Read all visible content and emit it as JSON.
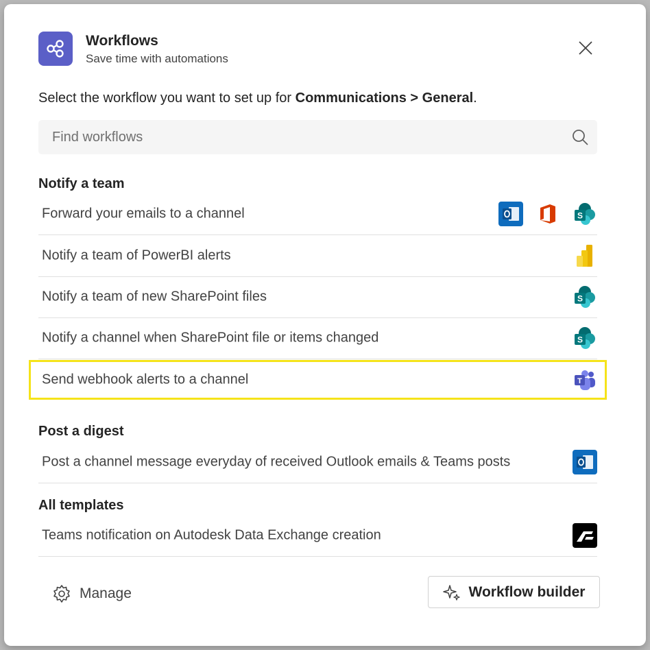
{
  "header": {
    "title": "Workflows",
    "subtitle": "Save time with automations",
    "app_icon": "workflows-icon",
    "close_icon": "close-icon"
  },
  "instruction": {
    "prefix": "Select the workflow you want to set up for ",
    "location": "Communications > General",
    "suffix": "."
  },
  "search": {
    "placeholder": "Find workflows",
    "icon": "search-icon"
  },
  "sections": {
    "notify": {
      "title": "Notify a team",
      "items": [
        {
          "label": "Forward your emails to a channel",
          "icons": [
            "outlook-icon",
            "office-icon",
            "sharepoint-icon"
          ]
        },
        {
          "label": "Notify a team of PowerBI alerts",
          "icons": [
            "powerbi-icon"
          ]
        },
        {
          "label": "Notify a team of new SharePoint files",
          "icons": [
            "sharepoint-icon"
          ]
        },
        {
          "label": "Notify a channel when SharePoint file or items changed",
          "icons": [
            "sharepoint-icon"
          ]
        },
        {
          "label": "Send webhook alerts to a channel",
          "icons": [
            "teams-icon"
          ],
          "highlighted": true,
          "highlight_color": "#f5e31a"
        }
      ]
    },
    "digest": {
      "title": "Post a digest",
      "items": [
        {
          "label": "Post a channel message everyday of received Outlook emails & Teams posts",
          "icons": [
            "outlook-icon"
          ]
        }
      ]
    },
    "all_templates": {
      "title": "All templates",
      "items": [
        {
          "label": "Teams notification on Autodesk Data Exchange creation",
          "icons": [
            "autodesk-icon"
          ]
        }
      ]
    }
  },
  "footer": {
    "manage_label": "Manage",
    "manage_icon": "gear-icon",
    "builder_label": "Workflow builder",
    "builder_icon": "sparkle-icon"
  },
  "colors": {
    "accent": "#5b5fc7",
    "highlight": "#f5e31a",
    "outlook": "#0f6cbd",
    "office": "#d83b01",
    "sharepoint": "#038387",
    "powerbi": "#f2c811"
  }
}
